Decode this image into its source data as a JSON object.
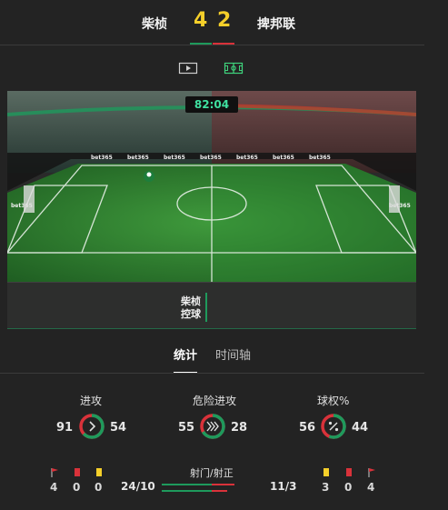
{
  "match": {
    "home_team": "柴桢",
    "away_team": "捭邦联",
    "home_score": "4",
    "away_score": "2",
    "colors": {
      "home": "#1e9a5c",
      "away": "#d9323a",
      "score": "#f5cf2a"
    }
  },
  "view_toggle": {
    "video_icon": "play-screen-icon",
    "pitch_icon": "pitch-icon"
  },
  "field": {
    "clock": "82:04",
    "ad_text": "bet365",
    "event_team": "柴桢",
    "event_action": "控球"
  },
  "tabs": [
    {
      "label": "统计",
      "active": true
    },
    {
      "label": "时间轴",
      "active": false
    }
  ],
  "stats": [
    {
      "label": "进攻",
      "home": "91",
      "away": "54",
      "icon": "chevron-right-icon"
    },
    {
      "label": "危险进攻",
      "home": "55",
      "away": "28",
      "icon": "triple-chevron-icon"
    },
    {
      "label": "球权%",
      "home": "56",
      "away": "44",
      "icon": "percent-icon"
    }
  ],
  "shots": {
    "label": "射门/射正",
    "home": "24/10",
    "away": "11/3",
    "home_total": 24,
    "away_total": 11,
    "home_on": 10,
    "away_on": 3
  },
  "home_counts": {
    "corners": "4",
    "red_cards": "0",
    "yellow_cards": "0"
  },
  "away_counts": {
    "yellow_cards": "3",
    "red_cards": "0",
    "corners": "4"
  }
}
